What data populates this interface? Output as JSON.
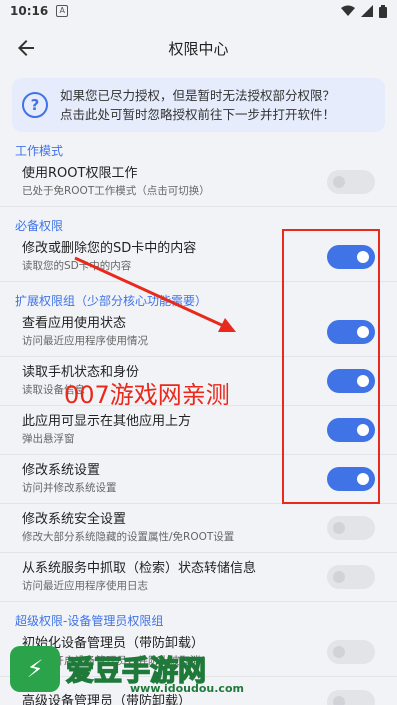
{
  "status_bar": {
    "time": "10:16",
    "badge": "A"
  },
  "app_bar": {
    "title": "权限中心"
  },
  "notice": {
    "line1": "如果您已尽力授权，但是暂时无法授权部分权限？",
    "line2": "点击此处可暂时忽略授权前往下一步并打开软件！"
  },
  "sections": {
    "work_mode": "工作模式",
    "required": "必备权限",
    "extended": "扩展权限组（少部分核心功能需要）",
    "super": "超级权限-设备管理员权限组"
  },
  "rows": {
    "root": {
      "title": "使用ROOT权限工作",
      "subtitle": "已处于免ROOT工作模式（点击可切换）",
      "enabled": false
    },
    "sdcard": {
      "title": "修改或删除您的SD卡中的内容",
      "subtitle": "读取您的SD卡中的内容",
      "enabled": true
    },
    "usage": {
      "title": "查看应用使用状态",
      "subtitle": "访问最近应用程序使用情况",
      "enabled": true
    },
    "phone": {
      "title": "读取手机状态和身份",
      "subtitle": "读取设备信息",
      "enabled": true
    },
    "overlay": {
      "title": "此应用可显示在其他应用上方",
      "subtitle": "弹出悬浮窗",
      "enabled": true
    },
    "settings": {
      "title": "修改系统设置",
      "subtitle": "访问并修改系统设置",
      "enabled": true
    },
    "secure": {
      "title": "修改系统安全设置",
      "subtitle": "修改大部分系统隐藏的设置属性/免ROOT设置",
      "enabled": false
    },
    "logs": {
      "title": "从系统服务中抓取（检索）状态转储信息",
      "subtitle": "访问最近应用程序使用日志",
      "enabled": false
    },
    "device_admin": {
      "title": "初始化设备管理员（带防卸载）",
      "subtitle": "在此处开启设备管理员，并防止被取消！",
      "enabled": false
    },
    "advanced_admin": {
      "title": "高级设备管理员（带防卸载）",
      "enabled": false
    }
  },
  "watermarks": {
    "overlay_text": "007游戏网亲测",
    "brand": "爱豆手游网",
    "site": "www.idoudou.com"
  },
  "colors": {
    "accent": "#3f73e6",
    "annotation": "#e8291c"
  }
}
